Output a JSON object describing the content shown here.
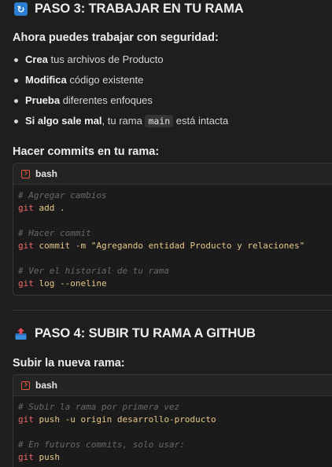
{
  "step3": {
    "title": "PASO 3: TRABAJAR EN TU RAMA",
    "intro": "Ahora puedes trabajar con seguridad:",
    "bullets": [
      {
        "bold": "Crea",
        "rest": " tus archivos de Producto"
      },
      {
        "bold": "Modifica",
        "rest": " código existente"
      },
      {
        "bold": "Prueba",
        "rest": " diferentes enfoques"
      },
      {
        "bold": "Si algo sale mal",
        "rest_pre": ", tu rama ",
        "code": "main",
        "rest_post": " está intacta"
      }
    ],
    "commits_heading": "Hacer commits en tu rama:",
    "code": {
      "lang": "bash",
      "c1": "# Agregar cambios",
      "l1_cmd": "git",
      "l1_arg": " add .",
      "c2": "# Hacer commit",
      "l2_cmd": "git",
      "l2_arg": " commit -m \"Agregando entidad Producto y relaciones\"",
      "c3": "# Ver el historial de tu rama",
      "l3_cmd": "git",
      "l3_arg": " log --oneline"
    }
  },
  "step4": {
    "title": "PASO 4: SUBIR TU RAMA A GITHUB",
    "heading": "Subir la nueva rama:",
    "code": {
      "lang": "bash",
      "c1": "# Subir la rama por primera vez",
      "l1_cmd": "git",
      "l1_arg": " push -u origin desarrollo-producto",
      "c2": "# En futuros commits, solo usar:",
      "l2_cmd": "git",
      "l2_arg": " push"
    }
  }
}
